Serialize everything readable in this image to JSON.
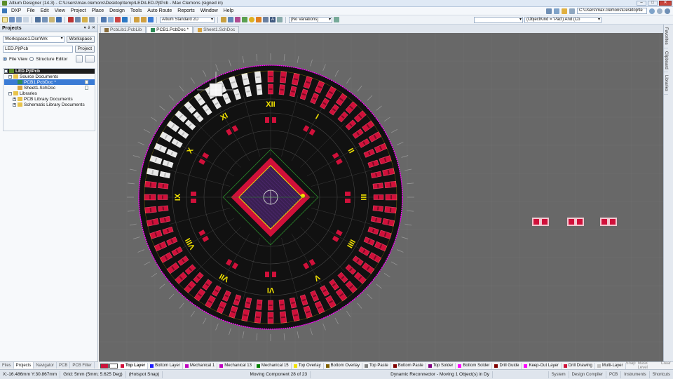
{
  "window": {
    "title": "Altium Designer (14.3) - C:\\Users\\max.clemons\\Desktop\\temp\\LED\\LED.PjtPcb - Max Clemons (signed in)",
    "min": "–",
    "max": "□",
    "close": "✕"
  },
  "menu": {
    "items": [
      "DXP",
      "File",
      "Edit",
      "View",
      "Project",
      "Place",
      "Design",
      "Tools",
      "Auto Route",
      "Reports",
      "Window",
      "Help"
    ],
    "path": "C:\\Users\\max.clemons\\Desktop\\te"
  },
  "toolbar": {
    "view_mode": "Altium Standard 2D",
    "variations": "[No Variations]",
    "filter": "(ObjectKind = 'Pad') And (Co"
  },
  "projects_panel": {
    "title": "Projects",
    "controls": "▾ ⇓ ✕",
    "workspace_value": "Workspace1.DsnWrk",
    "workspace_button": "Workspace",
    "project_value": "LED.PjtPcb",
    "project_button": "Project",
    "view_file": "File View",
    "view_structure": "Structure Editor",
    "tree": [
      {
        "label": "LED.PjtPcb",
        "indent": 0,
        "expander": "−",
        "style": "dark",
        "icon_color": "#5b8c2a"
      },
      {
        "label": "Source Documents",
        "indent": 1,
        "expander": "−",
        "style": "",
        "icon_color": "#e8c34a"
      },
      {
        "label": "PCB1.PcbDoc *",
        "indent": 2,
        "expander": "",
        "style": "blue",
        "icon_color": "#2e8b57"
      },
      {
        "label": "Sheet1.SchDoc",
        "indent": 2,
        "expander": "",
        "style": "",
        "icon_color": "#d9a441"
      },
      {
        "label": "Libraries",
        "indent": 1,
        "expander": "−",
        "style": "",
        "icon_color": "#e8c34a"
      },
      {
        "label": "PCB Library Documents",
        "indent": 2,
        "expander": "+",
        "style": "",
        "icon_color": "#e8c34a"
      },
      {
        "label": "Schematic Library Documents",
        "indent": 2,
        "expander": "+",
        "style": "",
        "icon_color": "#e8c34a"
      }
    ],
    "bottom_tabs": [
      "Files",
      "Projects",
      "Navigator",
      "PCB",
      "PCB Filter"
    ],
    "active_bottom_tab": "Projects"
  },
  "doc_tabs": [
    {
      "label": "PcbLib1.PcbLib",
      "active": false,
      "icon_color": "#8a6d3b"
    },
    {
      "label": "PCB1.PcbDoc *",
      "active": true,
      "icon_color": "#2e8b57"
    },
    {
      "label": "Sheet1.SchDoc",
      "active": false,
      "icon_color": "#d9a441"
    }
  ],
  "right_panels": [
    "Favorites",
    "Clipboard",
    "Libraries"
  ],
  "board": {
    "clock_numerals": [
      "XII",
      "I",
      "II",
      "III",
      "IIII",
      "V",
      "VI",
      "VII",
      "VIII",
      "IX",
      "X",
      "XI"
    ],
    "colors": {
      "canvas": "#686868",
      "board": "#111111",
      "pad": "#d0103a",
      "overlay": "#f2e200",
      "outline": "#ff00ff",
      "selection": "#e8e8e8",
      "chip_body": "#3a1f52",
      "grid": "#8a8a8a"
    }
  },
  "layers": {
    "active": "Top Layer",
    "items": [
      {
        "name": "Top Layer",
        "color": "#d0103a"
      },
      {
        "name": "Bottom Layer",
        "color": "#1c1cff"
      },
      {
        "name": "Mechanical 1",
        "color": "#c000c0"
      },
      {
        "name": "Mechanical 13",
        "color": "#c000c0"
      },
      {
        "name": "Mechanical 15",
        "color": "#008000"
      },
      {
        "name": "Top Overlay",
        "color": "#f2e200"
      },
      {
        "name": "Bottom Overlay",
        "color": "#806000"
      },
      {
        "name": "Top Paste",
        "color": "#808080"
      },
      {
        "name": "Bottom Paste",
        "color": "#800000"
      },
      {
        "name": "Top Solder",
        "color": "#800080"
      },
      {
        "name": "Bottom Solder",
        "color": "#ff00ff"
      },
      {
        "name": "Drill Guide",
        "color": "#800000"
      },
      {
        "name": "Keep-Out Layer",
        "color": "#ff00ff"
      },
      {
        "name": "Drill Drawing",
        "color": "#d0103a"
      },
      {
        "name": "Multi-Layer",
        "color": "#c0c0c0"
      }
    ],
    "controls": [
      "Snap",
      "Mask Level",
      "Clear"
    ]
  },
  "status": {
    "coords": "X:-16.486mm Y:30.867mm",
    "grid": "Grid: 5mm (5mm; 5.625 Deg)",
    "snap": "(Hotspot Snap)",
    "moving": "Moving Component 28 of 23",
    "reconnector": "Dynamic Reconnector - Moving 1 Object(s) in Dy",
    "panels": [
      "System",
      "Design Compiler",
      "PCB",
      "Instruments",
      "Shortcuts"
    ]
  }
}
